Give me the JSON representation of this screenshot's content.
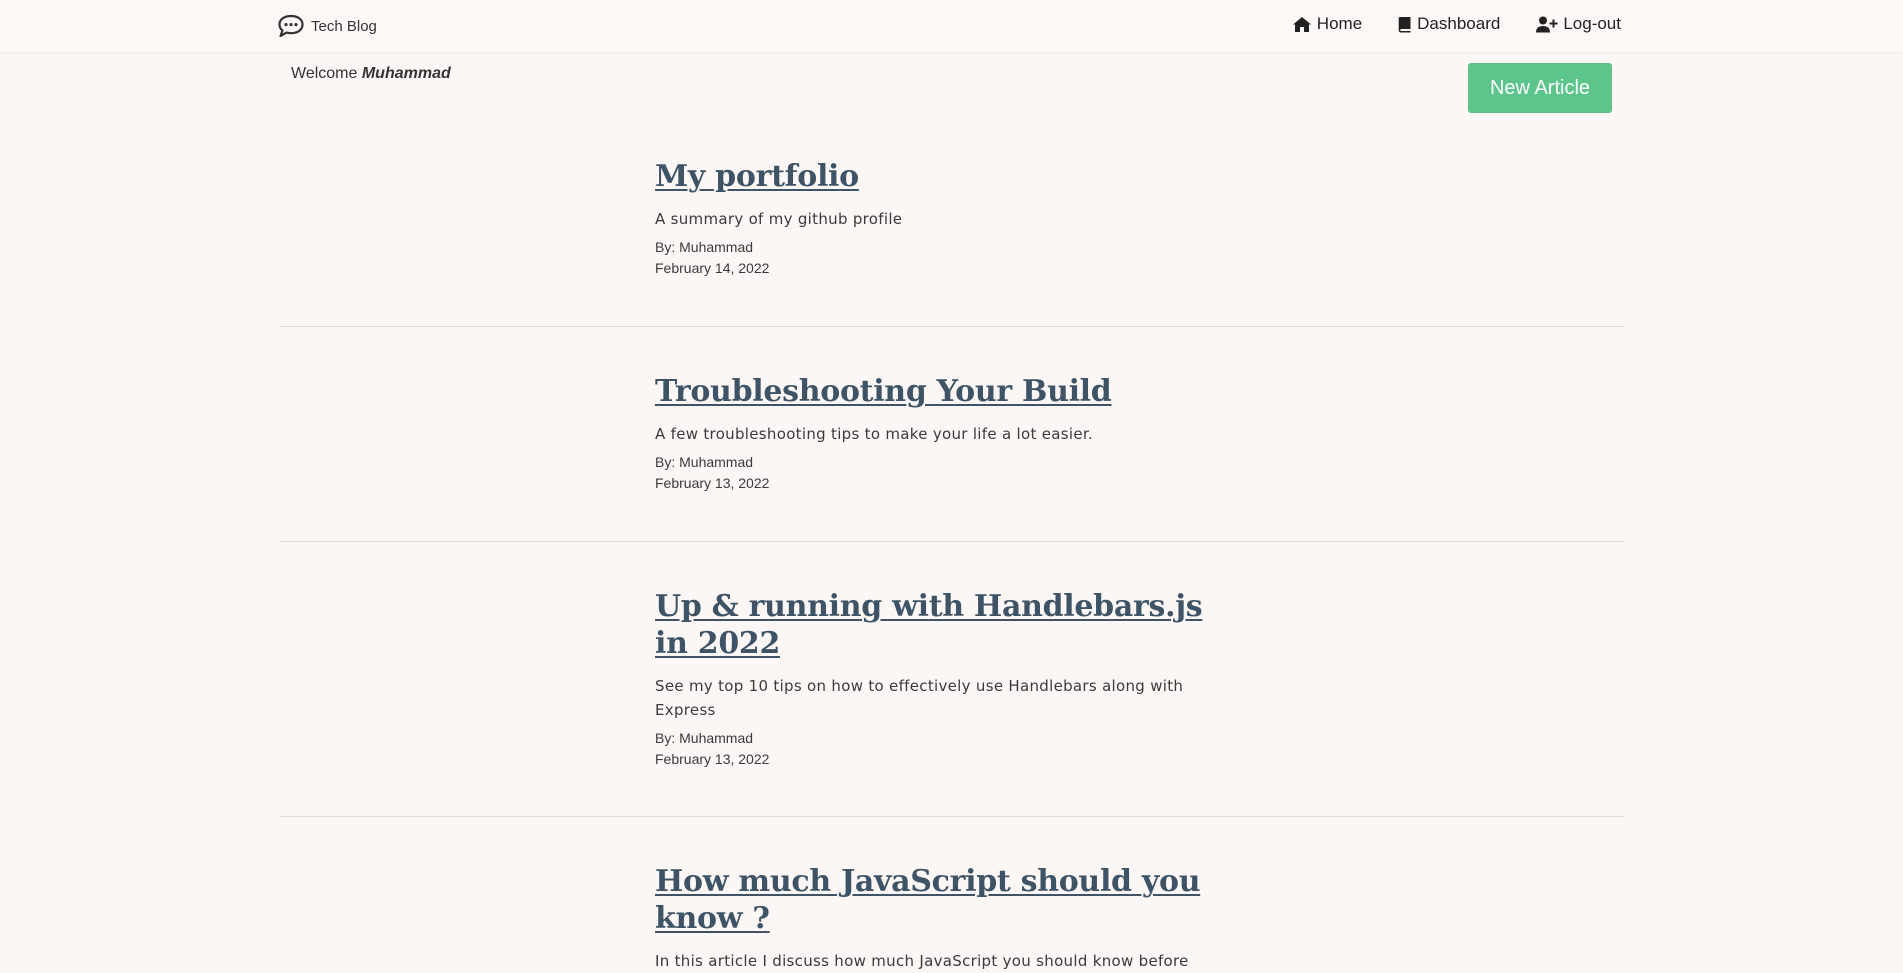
{
  "nav": {
    "brand": "Tech Blog",
    "links": [
      {
        "label": "Home",
        "icon": "home-icon"
      },
      {
        "label": "Dashboard",
        "icon": "book-icon"
      },
      {
        "label": "Log-out",
        "icon": "user-plus-icon"
      }
    ]
  },
  "welcome": {
    "prefix": "Welcome",
    "username": "Muhammad"
  },
  "new_article_label": "New Article",
  "colors": {
    "background": "#fcf7f5",
    "button": "#5cc58c",
    "title": "#3e5466"
  },
  "posts": [
    {
      "title": "My portfolio",
      "description": "A summary of my github profile",
      "author": "By: Muhammad",
      "date": "February 14, 2022"
    },
    {
      "title": "Troubleshooting Your Build",
      "description": "A few troubleshooting tips to make your life a lot easier.",
      "author": "By: Muhammad",
      "date": "February 13, 2022"
    },
    {
      "title": "Up & running with Handlebars.js in 2022",
      "description": "See my top 10 tips on how to effectively use Handlebars along with Express",
      "author": "By: Muhammad",
      "date": "February 13, 2022"
    },
    {
      "title": "How much JavaScript should you know ?",
      "description": "In this article I discuss how much JavaScript you should know before",
      "author": "",
      "date": ""
    }
  ]
}
